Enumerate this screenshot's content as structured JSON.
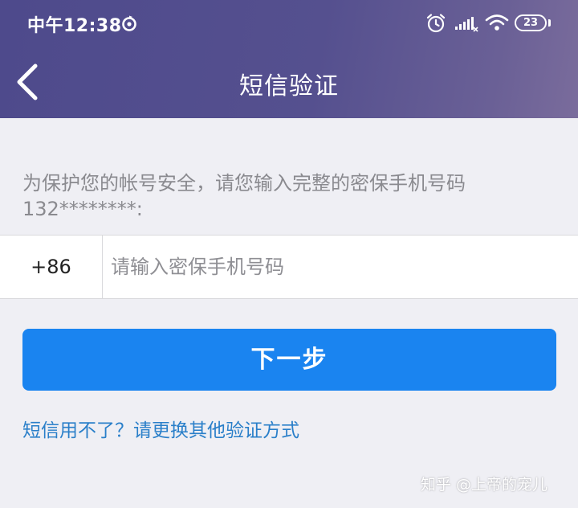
{
  "status_bar": {
    "time": "中午12:38",
    "battery_level": "23",
    "icons": [
      "sync-icon",
      "alarm-icon",
      "signal-icon",
      "wifi-icon",
      "battery-icon"
    ]
  },
  "navbar": {
    "title": "短信验证",
    "back_icon": "chevron-left-icon"
  },
  "prompt": {
    "line1": "为保护您的帐号安全，请您输入完整的密保手机号码",
    "line2": "132********:"
  },
  "phone_field": {
    "country_code": "+86",
    "value": "",
    "placeholder": "请输入密保手机号码"
  },
  "actions": {
    "next_label": "下一步",
    "alt_link_label": "短信用不了？请更换其他验证方式"
  },
  "watermark": "知乎 @上帝的宠儿",
  "colors": {
    "header_gradient_start": "#4e4a8c",
    "header_gradient_end": "#7a6c9c",
    "primary_button": "#1a84f0",
    "link": "#2a7fc9",
    "page_background": "#efeff4"
  }
}
